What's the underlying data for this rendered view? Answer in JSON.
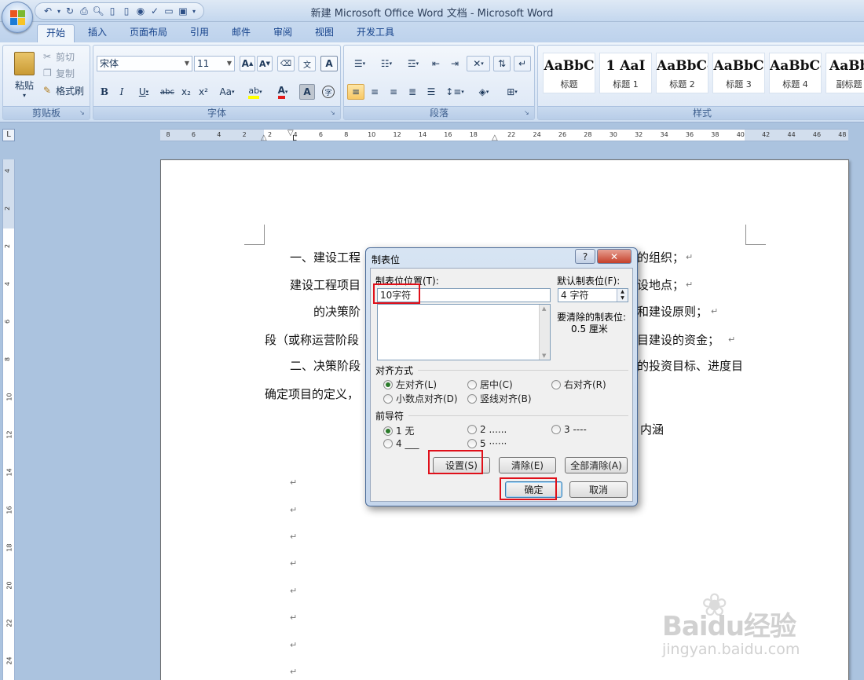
{
  "window": {
    "title": "新建 Microsoft Office Word 文档 - Microsoft Word"
  },
  "qat": {
    "icons": [
      "undo-icon",
      "redo-icon",
      "print-icon",
      "preview-icon",
      "new-icon",
      "save-icon"
    ]
  },
  "tabs": [
    "开始",
    "插入",
    "页面布局",
    "引用",
    "邮件",
    "审阅",
    "视图",
    "开发工具"
  ],
  "ribbon": {
    "clipboard": {
      "paste": "粘贴",
      "cut": "剪切",
      "copy": "复制",
      "format_painter": "格式刷",
      "label": "剪贴板"
    },
    "font": {
      "name": "宋体",
      "size": "11",
      "grow": "A",
      "shrink": "A",
      "change_case": "Aa",
      "label": "字体"
    },
    "paragraph": {
      "label": "段落"
    },
    "styles": {
      "label": "样式",
      "items": [
        {
          "sample": "AaBbC",
          "name": "标题"
        },
        {
          "sample": "1  AaI",
          "name": "标题 1"
        },
        {
          "sample": "AaBbCc",
          "name": "标题 2"
        },
        {
          "sample": "AaBbC",
          "name": "标题 3"
        },
        {
          "sample": "AaBbCc",
          "name": "标题 4"
        },
        {
          "sample": "AaBb",
          "name": "副标题"
        }
      ]
    }
  },
  "ruler": {
    "h_numbers": [
      "8",
      "6",
      "4",
      "2",
      "2",
      "4",
      "6",
      "8",
      "10",
      "12",
      "14",
      "16",
      "18",
      "22",
      "24",
      "26",
      "28",
      "30",
      "32",
      "34",
      "36",
      "38",
      "40",
      "42",
      "44",
      "46",
      "48"
    ],
    "v_numbers": [
      "4",
      "2",
      "2",
      "4",
      "6",
      "8",
      "10",
      "12",
      "14",
      "16",
      "18",
      "20",
      "22",
      "24"
    ]
  },
  "document": {
    "lines": [
      {
        "left": "一、建设工程",
        "right": "的组织；"
      },
      {
        "left": "建设工程项目",
        "right": "设地点；"
      },
      {
        "left": "的决策阶",
        "right": "和建设原则；"
      },
      {
        "left": "段（或称运营阶段",
        "right": "目建设的资金；"
      },
      {
        "left": "二、决策阶段",
        "right": "的投资目标、进度目"
      },
      {
        "left": "确定项目的定义，",
        "right": ""
      },
      {
        "left": "",
        "right": "内涵"
      }
    ],
    "para_mark": "↵"
  },
  "dialog": {
    "title": "制表位",
    "help": "?",
    "close": "✕",
    "position_label": "制表位位置(T):",
    "position_value": "10字符",
    "default_label": "默认制表位(F):",
    "default_value": "4 字符",
    "clear_label": "要清除的制表位:",
    "clear_value": "0.5 厘米",
    "alignment_label": "对齐方式",
    "alignment": [
      {
        "label": "左对齐(L)",
        "selected": true
      },
      {
        "label": "居中(C)",
        "selected": false
      },
      {
        "label": "右对齐(R)",
        "selected": false
      },
      {
        "label": "小数点对齐(D)",
        "selected": false
      },
      {
        "label": "竖线对齐(B)",
        "selected": false
      }
    ],
    "leader_label": "前导符",
    "leaders": [
      {
        "label": "1 无",
        "selected": true
      },
      {
        "label": "2 ......",
        "selected": false
      },
      {
        "label": "3 ----",
        "selected": false
      },
      {
        "label": "4 ___",
        "selected": false
      },
      {
        "label": "5 ······",
        "selected": false
      }
    ],
    "set_button": "设置(S)",
    "clear_button": "清除(E)",
    "clear_all_button": "全部清除(A)",
    "ok_button": "确定",
    "cancel_button": "取消"
  },
  "watermark": {
    "brand": "Baidu经验",
    "url": "jingyan.baidu.com"
  },
  "colors": {
    "highlight": "#e0101a",
    "title_text": "#15428b"
  }
}
